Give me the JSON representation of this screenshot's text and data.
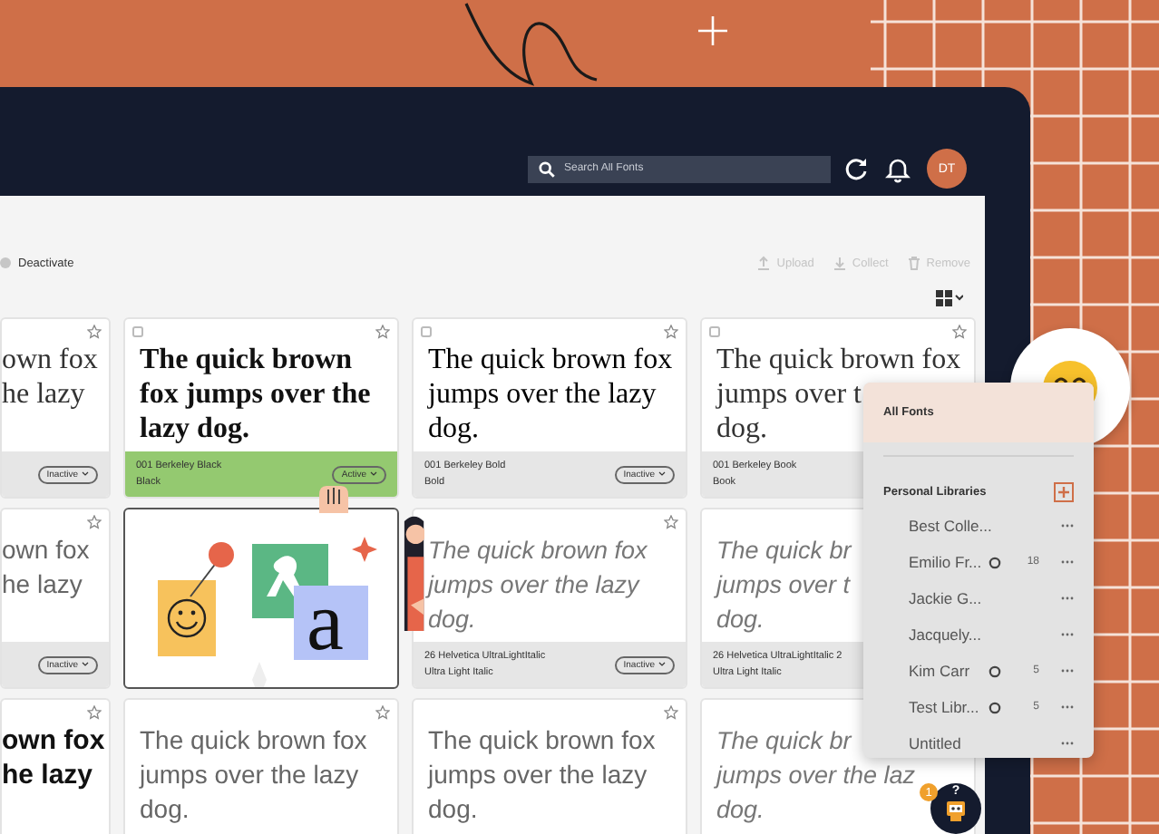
{
  "header": {
    "search": {
      "placeholder": "Search All Fonts"
    },
    "avatar": {
      "initials": "DT"
    }
  },
  "toolbar": {
    "deactivate": {
      "label": "Deactivate"
    },
    "actions": [
      {
        "kind": "upload",
        "label": "Upload",
        "disabled": true
      },
      {
        "kind": "collect",
        "label": "Collect",
        "disabled": true
      },
      {
        "kind": "remove",
        "label": "Remove",
        "disabled": true
      }
    ]
  },
  "cards": [
    {
      "kind": "serif-book",
      "starred": false,
      "lines": [
        "own fox",
        "he lazy"
      ],
      "footer": {
        "status": "Inactive"
      },
      "active": false
    },
    {
      "kind": "serif-black",
      "checked": false,
      "starred": false,
      "lines": [
        "The quick brown",
        "fox jumps over the",
        "lazy dog."
      ],
      "footer": {
        "name": "001 Berkeley Black",
        "weight": "Black",
        "status": "Active"
      },
      "active": true
    },
    {
      "kind": "serif-bold",
      "checked": false,
      "starred": false,
      "lines": [
        "The quick brown fox",
        "jumps over the lazy",
        "dog."
      ],
      "footer": {
        "name": "001 Berkeley Bold",
        "weight": "Bold",
        "status": "Inactive"
      },
      "active": false
    },
    {
      "kind": "serif-book",
      "checked": false,
      "starred": false,
      "lines": [
        "The quick brown fox",
        "jumps over t",
        "dog."
      ],
      "footer": {
        "name": "001 Berkeley Book",
        "weight": "Book"
      },
      "active": false
    },
    {
      "kind": "sans-light",
      "starred": false,
      "lines": [
        "own fox",
        "he lazy"
      ],
      "footer": {
        "status": "Inactive"
      },
      "active": false
    },
    {
      "kind": "illustration",
      "letter": "a"
    },
    {
      "kind": "sans-light-italic",
      "starred": false,
      "lines": [
        "The quick brown fox",
        "jumps over the lazy",
        "dog."
      ],
      "footer": {
        "name": "26 Helvetica UltraLightItalic",
        "weight": "Ultra Light Italic",
        "status": "Inactive"
      },
      "active": false
    },
    {
      "kind": "sans-light-italic",
      "lines": [
        "The quick br",
        "jumps over t",
        "dog."
      ],
      "footer": {
        "name": "26 Helvetica UltraLightItalic 2",
        "weight": "Ultra Light Italic"
      },
      "active": false
    },
    {
      "kind": "sans-bold",
      "starred": false,
      "lines": [
        "own fox",
        "he lazy"
      ]
    },
    {
      "kind": "sans-light",
      "starred": false,
      "lines": [
        "The quick brown fox",
        "jumps over the lazy",
        "dog."
      ]
    },
    {
      "kind": "sans-light",
      "starred": false,
      "lines": [
        "The quick brown fox",
        "jumps over the lazy",
        "dog."
      ]
    },
    {
      "kind": "sans-light-italic",
      "lines": [
        "The quick br",
        "jumps over the laz",
        "dog."
      ]
    }
  ],
  "library_panel": {
    "all_fonts": {
      "label": "All Fonts",
      "selected": true
    },
    "heading": "Personal Libraries",
    "libraries": [
      {
        "name": "Best Colle...",
        "shared": false,
        "selected": false
      },
      {
        "name": "Emilio Fr...",
        "shared": true,
        "count": "18",
        "selected": false
      },
      {
        "name": "Jackie G...",
        "shared": false,
        "selected": false
      },
      {
        "name": "Jacquely...",
        "shared": false,
        "selected": false
      },
      {
        "name": "Kim Carr",
        "shared": true,
        "count": "5",
        "selected": false
      },
      {
        "name": "Test Libr...",
        "shared": true,
        "count": "5",
        "selected": false
      },
      {
        "name": "Untitled",
        "shared": false,
        "selected": false
      }
    ]
  },
  "help": {
    "badge": "1",
    "label": "?"
  }
}
